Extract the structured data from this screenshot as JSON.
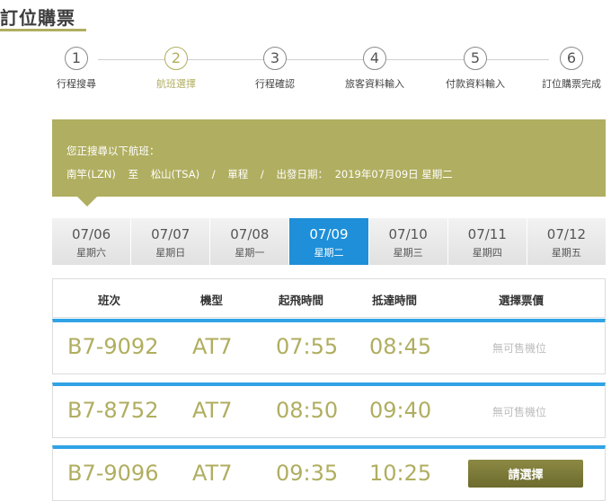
{
  "page": {
    "title": "訂位購票"
  },
  "stepper": {
    "steps": [
      {
        "number": "1",
        "label": "行程搜尋"
      },
      {
        "number": "2",
        "label": "航班選擇"
      },
      {
        "number": "3",
        "label": "行程確認"
      },
      {
        "number": "4",
        "label": "旅客資料輸入"
      },
      {
        "number": "5",
        "label": "付款資料輸入"
      },
      {
        "number": "6",
        "label": "訂位購票完成"
      }
    ],
    "active_step": "2"
  },
  "search_info": {
    "heading": "您正搜尋以下航班：",
    "origin": "南竿(LZN)",
    "to": "至",
    "destination": "松山(TSA)",
    "sep1": "/",
    "trip_type": "單程",
    "sep2": "/",
    "departure_label": "出發日期：",
    "departure_date": "2019年07月09日 星期二"
  },
  "date_tabs": [
    {
      "date": "07/06",
      "day": "星期六"
    },
    {
      "date": "07/07",
      "day": "星期日"
    },
    {
      "date": "07/08",
      "day": "星期一"
    },
    {
      "date": "07/09",
      "day": "星期二"
    },
    {
      "date": "07/10",
      "day": "星期三"
    },
    {
      "date": "07/11",
      "day": "星期四"
    },
    {
      "date": "07/12",
      "day": "星期五"
    }
  ],
  "selected_date": "07/09",
  "table": {
    "headers": {
      "flight": "班次",
      "aircraft": "機型",
      "departure": "起飛時間",
      "arrival": "抵達時間",
      "fare": "選擇票價"
    },
    "rows": [
      {
        "flight": "B7-9092",
        "aircraft": "AT7",
        "departure": "07:55",
        "arrival": "08:45",
        "fare_status": "無可售機位"
      },
      {
        "flight": "B7-8752",
        "aircraft": "AT7",
        "departure": "08:50",
        "arrival": "09:40",
        "fare_status": "無可售機位"
      },
      {
        "flight": "B7-9096",
        "aircraft": "AT7",
        "departure": "09:35",
        "arrival": "10:25",
        "fare_button": "請選擇"
      }
    ]
  },
  "colors": {
    "accent_olive": "#b0ae60",
    "selected_blue": "#1e8fd8",
    "row_border_blue": "#2fa3e6",
    "button_dark_olive": "#7c7a38"
  }
}
